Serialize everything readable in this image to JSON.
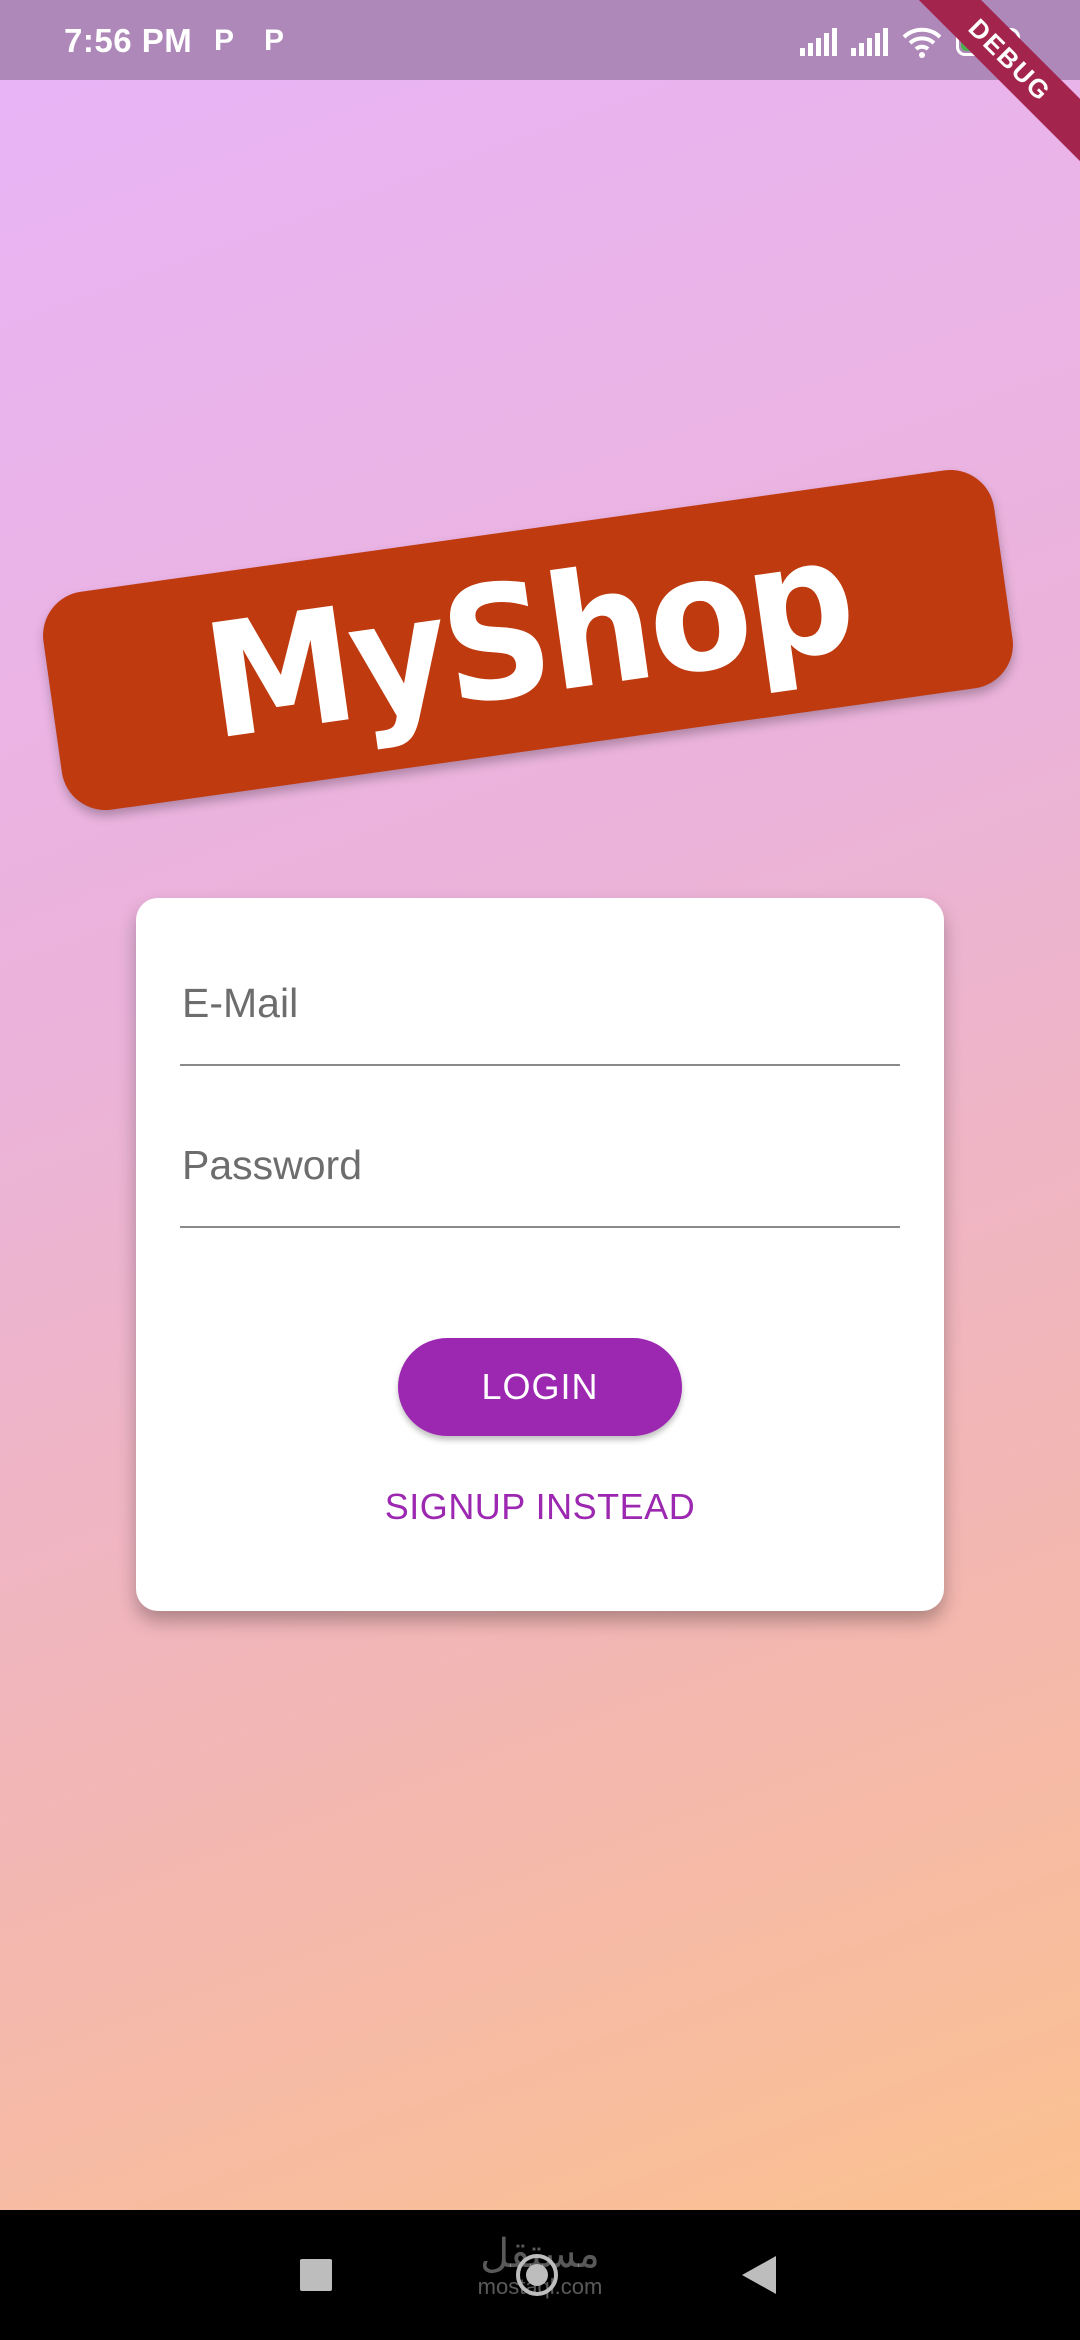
{
  "status_bar": {
    "time": "7:56 PM",
    "app_icon": "P",
    "battery_level": "96",
    "icons": [
      "p-app-icon",
      "signal-icon",
      "signal-icon",
      "wifi-icon",
      "battery-icon"
    ]
  },
  "debug_banner": "DEBUG",
  "logo": {
    "text": "MyShop"
  },
  "form": {
    "email_placeholder": "E-Mail",
    "email_value": "",
    "password_placeholder": "Password",
    "password_value": "",
    "login_label": "LOGIN",
    "signup_label": "SIGNUP INSTEAD"
  },
  "nav_bar": {
    "watermark_arabic": "مستقل",
    "watermark_latin": "mostaql.com",
    "icons": [
      "recent-apps-icon",
      "home-icon",
      "back-icon"
    ]
  },
  "colors": {
    "primary": "#9c27b0",
    "logo_bg": "#bf3a0f",
    "status_bar": "#ae88b8",
    "gradient_start": "#e8b4f8",
    "gradient_end": "#fdc38a"
  }
}
